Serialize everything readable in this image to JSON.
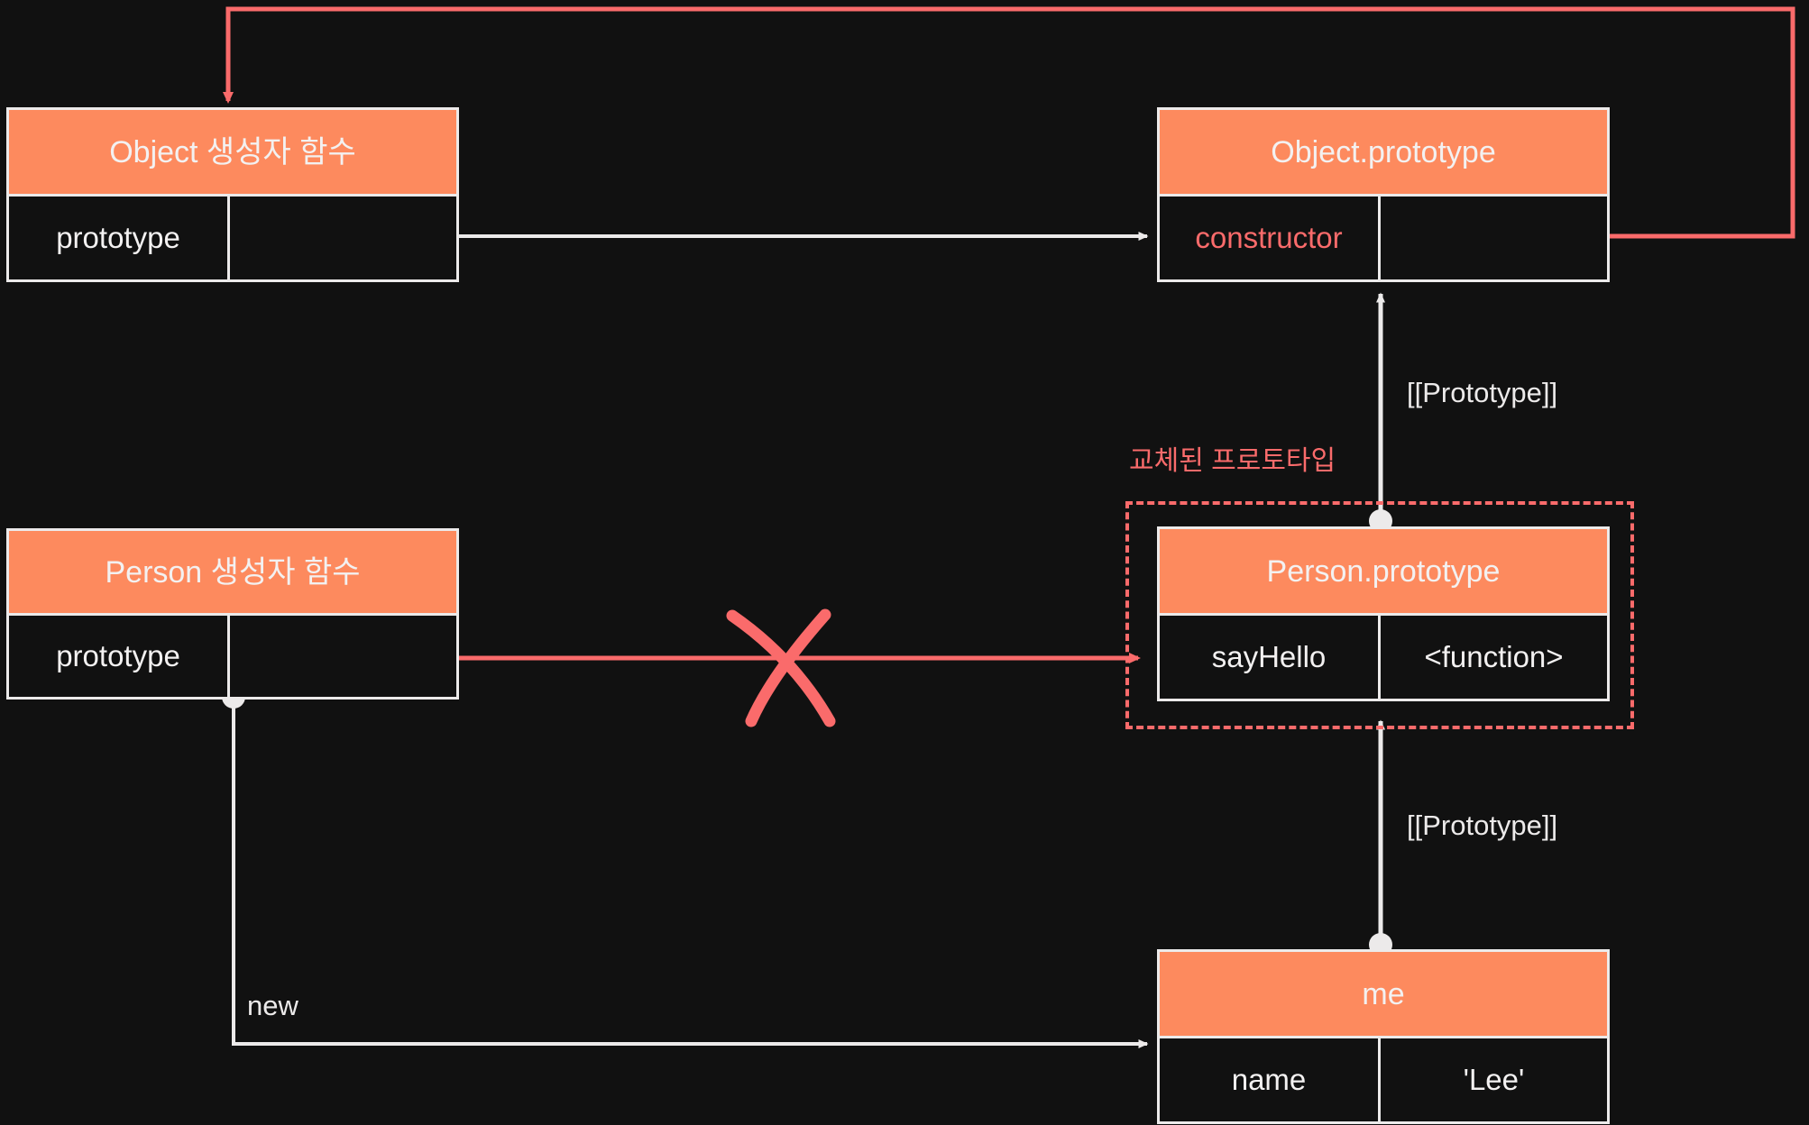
{
  "diagram": {
    "title": "JavaScript prototype chain with replaced Person.prototype",
    "background": "#111111",
    "colors": {
      "accent": "#fa6b6b",
      "header_fill": "#fd8a5e",
      "line": "#eceaea",
      "text": "#f3f1f1"
    }
  },
  "boxes": {
    "object_ctor": {
      "title": "Object 생성자 함수",
      "rows": [
        {
          "key": "prototype",
          "value": ""
        }
      ]
    },
    "object_prototype": {
      "title": "Object.prototype",
      "rows": [
        {
          "key": "constructor",
          "value": ""
        }
      ]
    },
    "person_ctor": {
      "title": "Person 생성자 함수",
      "rows": [
        {
          "key": "prototype",
          "value": ""
        }
      ]
    },
    "person_prototype": {
      "title": "Person.prototype",
      "rows": [
        {
          "key": "sayHello",
          "value": "<function>"
        }
      ]
    },
    "me": {
      "title": "me",
      "rows": [
        {
          "key": "name",
          "value": "'Lee'"
        }
      ]
    }
  },
  "labels": {
    "replaced_prototype": "교체된 프로토타입",
    "prototype_link_upper": "[[Prototype]]",
    "prototype_link_lower": "[[Prototype]]",
    "new_keyword": "new"
  }
}
